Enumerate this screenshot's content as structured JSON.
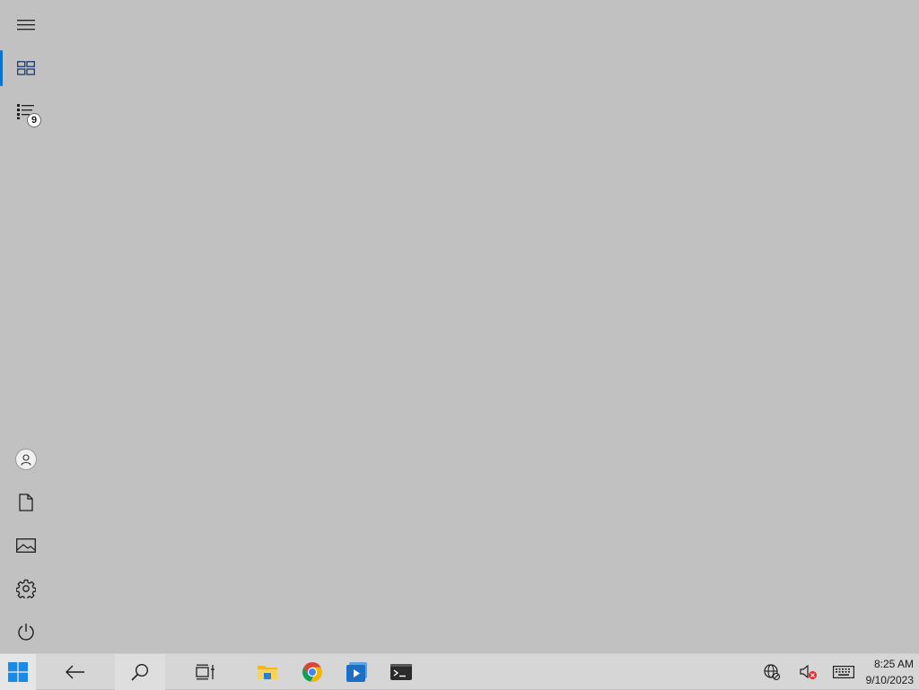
{
  "rail": {
    "items": [
      {
        "name": "menu",
        "icon": "hamburger-icon"
      },
      {
        "name": "dashboard",
        "icon": "tiles-icon",
        "active": true
      },
      {
        "name": "task-list",
        "icon": "list-icon",
        "badge": "9"
      },
      {
        "name": "user",
        "icon": "user-icon"
      },
      {
        "name": "documents",
        "icon": "document-icon"
      },
      {
        "name": "pictures",
        "icon": "picture-icon"
      },
      {
        "name": "settings",
        "icon": "gear-icon"
      },
      {
        "name": "power",
        "icon": "power-icon"
      }
    ],
    "accent": "#0a74d6"
  },
  "taskbar": {
    "apps": [
      {
        "name": "start",
        "icon": "windows-logo-icon"
      },
      {
        "name": "back",
        "icon": "back-arrow-icon"
      },
      {
        "name": "search",
        "icon": "search-icon"
      },
      {
        "name": "task-view",
        "icon": "task-view-icon"
      },
      {
        "name": "file-explorer",
        "icon": "folder-icon"
      },
      {
        "name": "chrome",
        "icon": "chrome-icon"
      },
      {
        "name": "media-player",
        "icon": "media-player-icon"
      },
      {
        "name": "terminal",
        "icon": "terminal-icon"
      }
    ],
    "tray": {
      "network_icon": "globe-network-icon",
      "volume_icon": "volume-muted-icon",
      "keyboard_icon": "keyboard-icon"
    },
    "clock": {
      "time": "8:25 AM",
      "date": "9/10/2023"
    }
  }
}
